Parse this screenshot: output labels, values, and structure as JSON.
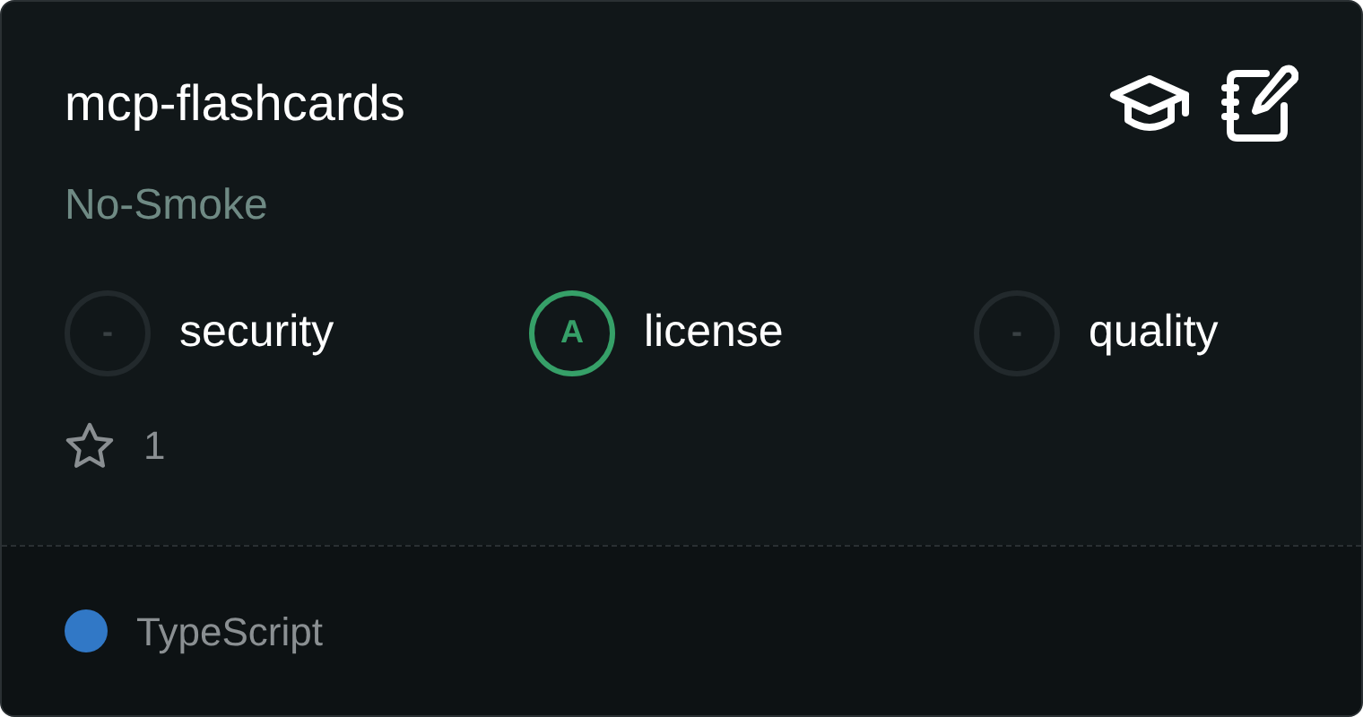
{
  "card": {
    "title": "mcp-flashcards",
    "owner": "No-Smoke",
    "scores": [
      {
        "grade": "-",
        "label": "security",
        "rated": false
      },
      {
        "grade": "A",
        "label": "license",
        "rated": true
      },
      {
        "grade": "-",
        "label": "quality",
        "rated": false
      }
    ],
    "stars": "1",
    "language": {
      "name": "TypeScript",
      "color": "#3178c6"
    }
  }
}
